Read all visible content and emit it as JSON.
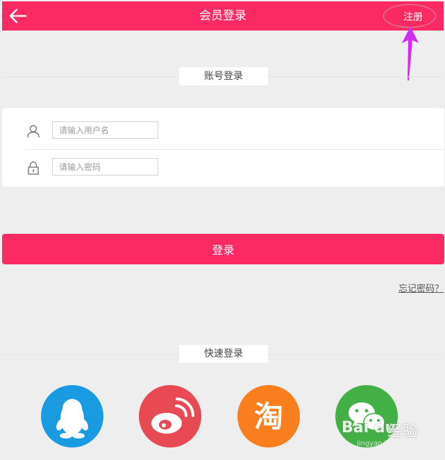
{
  "header": {
    "title": "会员登录",
    "register_label": "注册"
  },
  "account_section": {
    "label": "账号登录"
  },
  "form": {
    "username_placeholder": "请输入用户名",
    "password_placeholder": "请输入密码"
  },
  "login_button": {
    "label": "登录"
  },
  "forgot_password": {
    "label": "忘记密码？"
  },
  "quick_login": {
    "label": "快速登录",
    "providers": [
      {
        "icon": "qq-penguin-icon",
        "color": "#1a9ae0"
      },
      {
        "icon": "weibo-icon",
        "color": "#e84a54"
      },
      {
        "icon": "taobao-icon",
        "color": "#fa7d1e"
      },
      {
        "icon": "wechat-icon",
        "color": "#42b045"
      }
    ]
  },
  "watermark": {
    "brand": "Bai du",
    "brand_cn": "经验",
    "url": "jingyan.baidu.com"
  },
  "colors": {
    "accent": "#fb2a63",
    "background": "#eeeeee",
    "annotation": "#d42cf2"
  }
}
